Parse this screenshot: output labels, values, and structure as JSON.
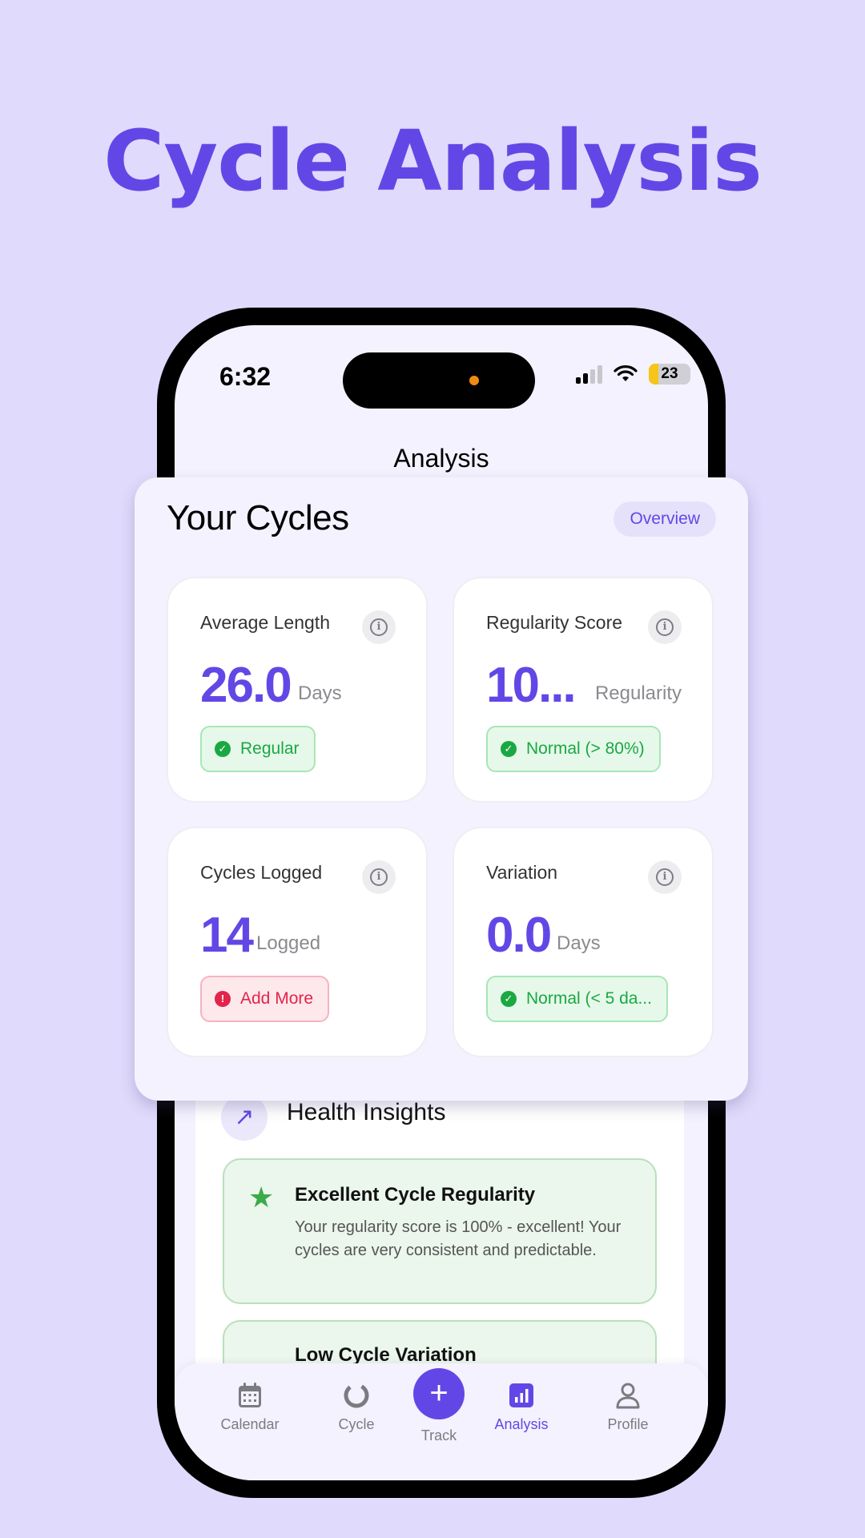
{
  "hero": {
    "title": "Cycle Analysis"
  },
  "status_bar": {
    "time": "6:32",
    "battery": "23"
  },
  "nav": {
    "title": "Analysis"
  },
  "cycles": {
    "title": "Your Cycles",
    "overview_label": "Overview",
    "stats": [
      {
        "label": "Average Length",
        "value": "26.0",
        "unit": "Days",
        "badge": "Regular",
        "status": "good"
      },
      {
        "label": "Regularity Score",
        "value": "10...",
        "unit": "Regularity",
        "badge": "Normal (> 80%)",
        "status": "good"
      },
      {
        "label": "Cycles Logged",
        "value": "14",
        "unit": "Logged",
        "badge": "Add More",
        "status": "warn"
      },
      {
        "label": "Variation",
        "value": "0.0",
        "unit": "Days",
        "badge": "Normal (< 5 da...",
        "status": "good"
      }
    ]
  },
  "insights": {
    "title": "Health Insights",
    "items": [
      {
        "title": "Excellent Cycle Regularity",
        "body": "Your regularity score is 100% - excellent! Your cycles are very consistent and predictable."
      },
      {
        "title": "Low Cycle Variation"
      }
    ]
  },
  "tabbar": {
    "items": [
      {
        "label": "Calendar",
        "icon": "calendar-icon"
      },
      {
        "label": "Cycle",
        "icon": "cycle-ring-icon"
      },
      {
        "label": "Track",
        "icon": "plus-icon"
      },
      {
        "label": "Analysis",
        "icon": "bar-chart-icon",
        "active": true
      },
      {
        "label": "Profile",
        "icon": "person-icon"
      }
    ]
  },
  "colors": {
    "accent": "#6347e6",
    "background": "#e0dafc",
    "good": "#1aa843",
    "warn": "#e2254a"
  }
}
